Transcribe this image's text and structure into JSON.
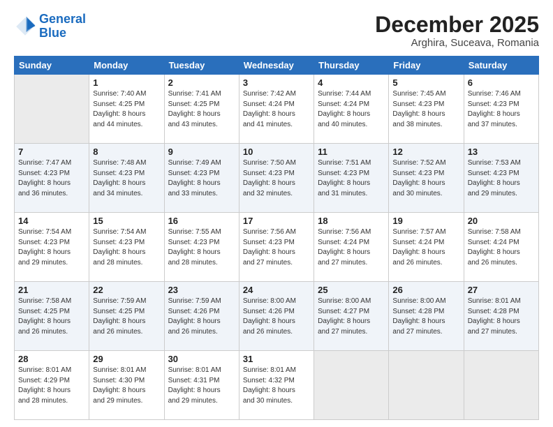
{
  "logo": {
    "line1": "General",
    "line2": "Blue"
  },
  "header": {
    "month": "December 2025",
    "location": "Arghira, Suceava, Romania"
  },
  "weekdays": [
    "Sunday",
    "Monday",
    "Tuesday",
    "Wednesday",
    "Thursday",
    "Friday",
    "Saturday"
  ],
  "weeks": [
    [
      {
        "day": "",
        "info": ""
      },
      {
        "day": "1",
        "info": "Sunrise: 7:40 AM\nSunset: 4:25 PM\nDaylight: 8 hours\nand 44 minutes."
      },
      {
        "day": "2",
        "info": "Sunrise: 7:41 AM\nSunset: 4:25 PM\nDaylight: 8 hours\nand 43 minutes."
      },
      {
        "day": "3",
        "info": "Sunrise: 7:42 AM\nSunset: 4:24 PM\nDaylight: 8 hours\nand 41 minutes."
      },
      {
        "day": "4",
        "info": "Sunrise: 7:44 AM\nSunset: 4:24 PM\nDaylight: 8 hours\nand 40 minutes."
      },
      {
        "day": "5",
        "info": "Sunrise: 7:45 AM\nSunset: 4:23 PM\nDaylight: 8 hours\nand 38 minutes."
      },
      {
        "day": "6",
        "info": "Sunrise: 7:46 AM\nSunset: 4:23 PM\nDaylight: 8 hours\nand 37 minutes."
      }
    ],
    [
      {
        "day": "7",
        "info": "Sunrise: 7:47 AM\nSunset: 4:23 PM\nDaylight: 8 hours\nand 36 minutes."
      },
      {
        "day": "8",
        "info": "Sunrise: 7:48 AM\nSunset: 4:23 PM\nDaylight: 8 hours\nand 34 minutes."
      },
      {
        "day": "9",
        "info": "Sunrise: 7:49 AM\nSunset: 4:23 PM\nDaylight: 8 hours\nand 33 minutes."
      },
      {
        "day": "10",
        "info": "Sunrise: 7:50 AM\nSunset: 4:23 PM\nDaylight: 8 hours\nand 32 minutes."
      },
      {
        "day": "11",
        "info": "Sunrise: 7:51 AM\nSunset: 4:23 PM\nDaylight: 8 hours\nand 31 minutes."
      },
      {
        "day": "12",
        "info": "Sunrise: 7:52 AM\nSunset: 4:23 PM\nDaylight: 8 hours\nand 30 minutes."
      },
      {
        "day": "13",
        "info": "Sunrise: 7:53 AM\nSunset: 4:23 PM\nDaylight: 8 hours\nand 29 minutes."
      }
    ],
    [
      {
        "day": "14",
        "info": "Sunrise: 7:54 AM\nSunset: 4:23 PM\nDaylight: 8 hours\nand 29 minutes."
      },
      {
        "day": "15",
        "info": "Sunrise: 7:54 AM\nSunset: 4:23 PM\nDaylight: 8 hours\nand 28 minutes."
      },
      {
        "day": "16",
        "info": "Sunrise: 7:55 AM\nSunset: 4:23 PM\nDaylight: 8 hours\nand 28 minutes."
      },
      {
        "day": "17",
        "info": "Sunrise: 7:56 AM\nSunset: 4:23 PM\nDaylight: 8 hours\nand 27 minutes."
      },
      {
        "day": "18",
        "info": "Sunrise: 7:56 AM\nSunset: 4:24 PM\nDaylight: 8 hours\nand 27 minutes."
      },
      {
        "day": "19",
        "info": "Sunrise: 7:57 AM\nSunset: 4:24 PM\nDaylight: 8 hours\nand 26 minutes."
      },
      {
        "day": "20",
        "info": "Sunrise: 7:58 AM\nSunset: 4:24 PM\nDaylight: 8 hours\nand 26 minutes."
      }
    ],
    [
      {
        "day": "21",
        "info": "Sunrise: 7:58 AM\nSunset: 4:25 PM\nDaylight: 8 hours\nand 26 minutes."
      },
      {
        "day": "22",
        "info": "Sunrise: 7:59 AM\nSunset: 4:25 PM\nDaylight: 8 hours\nand 26 minutes."
      },
      {
        "day": "23",
        "info": "Sunrise: 7:59 AM\nSunset: 4:26 PM\nDaylight: 8 hours\nand 26 minutes."
      },
      {
        "day": "24",
        "info": "Sunrise: 8:00 AM\nSunset: 4:26 PM\nDaylight: 8 hours\nand 26 minutes."
      },
      {
        "day": "25",
        "info": "Sunrise: 8:00 AM\nSunset: 4:27 PM\nDaylight: 8 hours\nand 27 minutes."
      },
      {
        "day": "26",
        "info": "Sunrise: 8:00 AM\nSunset: 4:28 PM\nDaylight: 8 hours\nand 27 minutes."
      },
      {
        "day": "27",
        "info": "Sunrise: 8:01 AM\nSunset: 4:28 PM\nDaylight: 8 hours\nand 27 minutes."
      }
    ],
    [
      {
        "day": "28",
        "info": "Sunrise: 8:01 AM\nSunset: 4:29 PM\nDaylight: 8 hours\nand 28 minutes."
      },
      {
        "day": "29",
        "info": "Sunrise: 8:01 AM\nSunset: 4:30 PM\nDaylight: 8 hours\nand 29 minutes."
      },
      {
        "day": "30",
        "info": "Sunrise: 8:01 AM\nSunset: 4:31 PM\nDaylight: 8 hours\nand 29 minutes."
      },
      {
        "day": "31",
        "info": "Sunrise: 8:01 AM\nSunset: 4:32 PM\nDaylight: 8 hours\nand 30 minutes."
      },
      {
        "day": "",
        "info": ""
      },
      {
        "day": "",
        "info": ""
      },
      {
        "day": "",
        "info": ""
      }
    ]
  ]
}
